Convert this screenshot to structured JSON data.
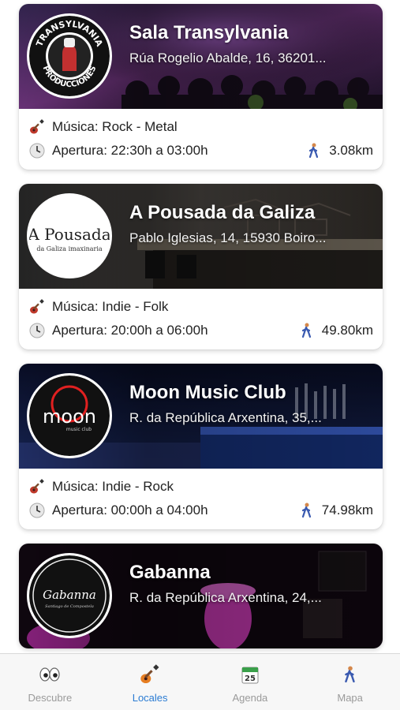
{
  "venues": [
    {
      "name": "Sala Transylvania",
      "address": "Rúa Rogelio Abalde, 16, 36201...",
      "music": "Música: Rock - Metal",
      "hours": "Apertura: 22:30h a 03:00h",
      "distance": "3.08km",
      "logo_text_top": "TRANSYLVANIA",
      "logo_text_bottom": "PRODUCCIONES"
    },
    {
      "name": "A Pousada da Galiza",
      "address": "Pablo Iglesias, 14, 15930 Boiro...",
      "music": "Música: Indie - Folk",
      "hours": "Apertura: 20:00h a 06:00h",
      "distance": "49.80km",
      "logo_text_main": "A Pousada",
      "logo_text_sub": "da Galiza imaxinaria"
    },
    {
      "name": "Moon Music Club",
      "address": "R. da República Arxentina, 35,...",
      "music": "Música: Indie - Rock",
      "hours": "Apertura: 00:00h a 04:00h",
      "distance": "74.98km",
      "logo_text_main": "moon",
      "logo_text_sub": "music club"
    },
    {
      "name": "Gabanna",
      "address": "R. da República Arxentina, 24,...",
      "logo_text_main": "Gabanna",
      "logo_text_sub": "Santiago de Compostela"
    }
  ],
  "tabs": [
    {
      "label": "Descubre",
      "icon": "eyes-icon"
    },
    {
      "label": "Locales",
      "icon": "guitar-icon"
    },
    {
      "label": "Agenda",
      "icon": "calendar-icon",
      "icon_text": "25"
    },
    {
      "label": "Mapa",
      "icon": "walking-person-icon"
    }
  ],
  "colors": {
    "active_tab": "#2b7cd3",
    "inactive_tab": "#9a9a9a",
    "accent_pink": "#e040c8"
  }
}
